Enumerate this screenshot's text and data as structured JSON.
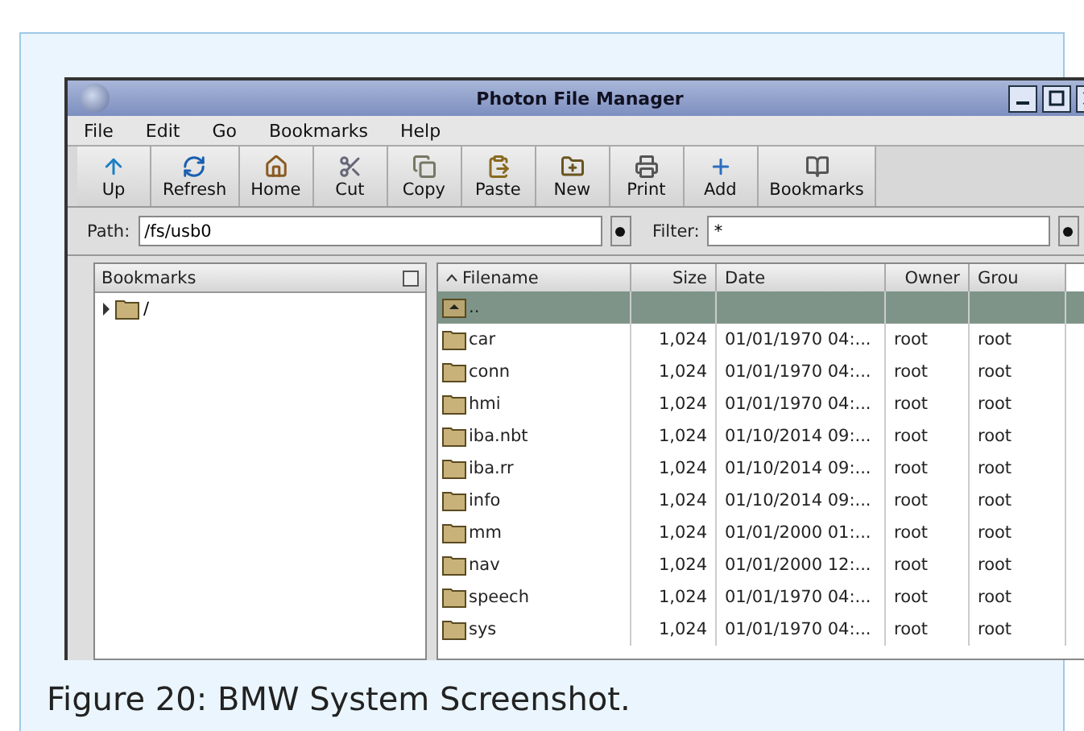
{
  "window": {
    "title": "Photon File Manager"
  },
  "menu": [
    "File",
    "Edit",
    "Go",
    "Bookmarks",
    "Help"
  ],
  "toolbar": [
    "Up",
    "Refresh",
    "Home",
    "Cut",
    "Copy",
    "Paste",
    "New",
    "Print",
    "Add",
    "Bookmarks"
  ],
  "path": {
    "label": "Path:",
    "value": "/fs/usb0"
  },
  "filter": {
    "label": "Filter:",
    "value": "*"
  },
  "bookmarks": {
    "title": "Bookmarks",
    "items": [
      {
        "label": "/",
        "expanded": false
      }
    ]
  },
  "table": {
    "columns": [
      "Filename",
      "Size",
      "Date",
      "Owner",
      "Grou"
    ],
    "rows": [
      {
        "kind": "parent",
        "name": "..",
        "size": "",
        "date": "",
        "owner": "",
        "group": "",
        "selected": true
      },
      {
        "kind": "folder",
        "name": "car",
        "size": "1,024",
        "date": "01/01/1970 04:...",
        "owner": "root",
        "group": "root",
        "selected": false
      },
      {
        "kind": "folder",
        "name": "conn",
        "size": "1,024",
        "date": "01/01/1970 04:...",
        "owner": "root",
        "group": "root",
        "selected": false
      },
      {
        "kind": "folder",
        "name": "hmi",
        "size": "1,024",
        "date": "01/01/1970 04:...",
        "owner": "root",
        "group": "root",
        "selected": false
      },
      {
        "kind": "folder",
        "name": "iba.nbt",
        "size": "1,024",
        "date": "01/10/2014 09:...",
        "owner": "root",
        "group": "root",
        "selected": false
      },
      {
        "kind": "folder",
        "name": "iba.rr",
        "size": "1,024",
        "date": "01/10/2014 09:...",
        "owner": "root",
        "group": "root",
        "selected": false
      },
      {
        "kind": "folder",
        "name": "info",
        "size": "1,024",
        "date": "01/10/2014 09:...",
        "owner": "root",
        "group": "root",
        "selected": false
      },
      {
        "kind": "folder",
        "name": "mm",
        "size": "1,024",
        "date": "01/01/2000 01:...",
        "owner": "root",
        "group": "root",
        "selected": false
      },
      {
        "kind": "folder",
        "name": "nav",
        "size": "1,024",
        "date": "01/01/2000 12:...",
        "owner": "root",
        "group": "root",
        "selected": false
      },
      {
        "kind": "folder",
        "name": "speech",
        "size": "1,024",
        "date": "01/01/1970 04:...",
        "owner": "root",
        "group": "root",
        "selected": false
      },
      {
        "kind": "folder",
        "name": "sys",
        "size": "1,024",
        "date": "01/01/1970 04:...",
        "owner": "root",
        "group": "root",
        "selected": false
      }
    ]
  },
  "caption": "Figure 20: BMW System Screenshot."
}
